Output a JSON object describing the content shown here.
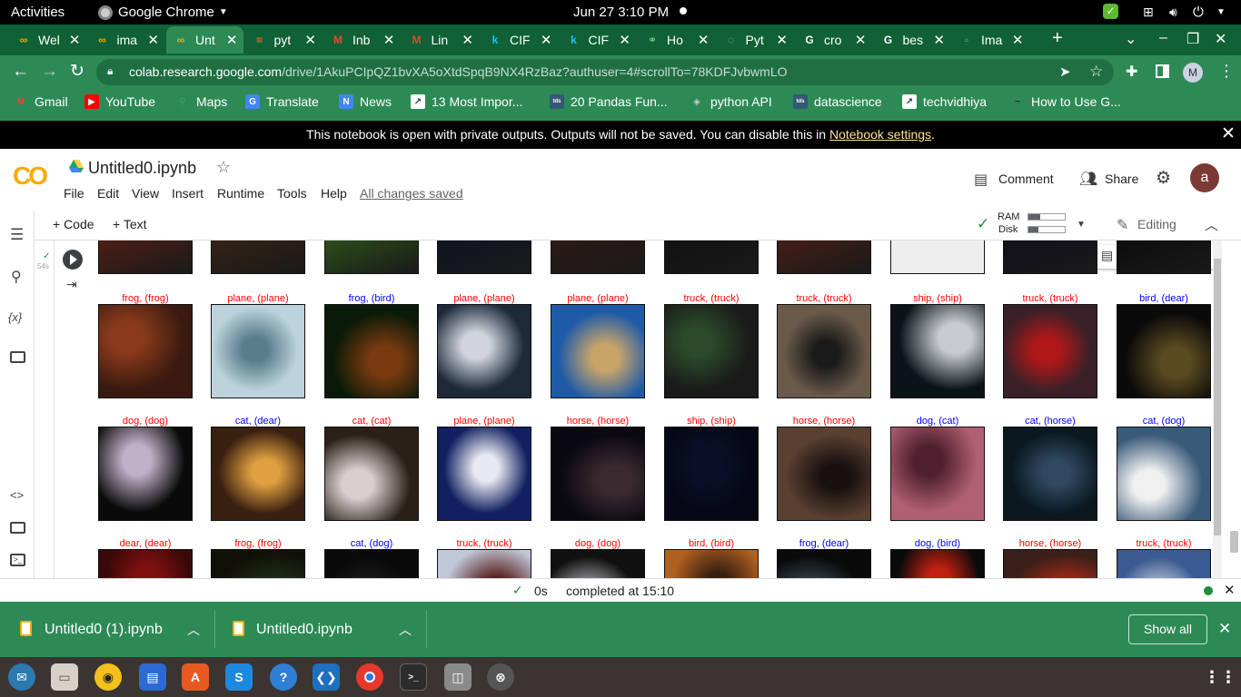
{
  "system": {
    "activities": "Activities",
    "app_name": "Google Chrome",
    "clock": "Jun 27  3:10 PM"
  },
  "tabs": [
    {
      "label": "Wel",
      "icon": "colab-icon"
    },
    {
      "label": "ima",
      "icon": "colab-icon"
    },
    {
      "label": "Unt",
      "icon": "colab-icon",
      "active": true
    },
    {
      "label": "pyt",
      "icon": "stackoverflow-icon"
    },
    {
      "label": "Inb",
      "icon": "gmail-icon"
    },
    {
      "label": "Lin",
      "icon": "gmail-icon"
    },
    {
      "label": "CIF",
      "icon": "kaggle-icon"
    },
    {
      "label": "CIF",
      "icon": "kaggle-icon"
    },
    {
      "label": "Ho",
      "icon": "link-icon"
    },
    {
      "label": "Pyt",
      "icon": "loading-icon"
    },
    {
      "label": "cro",
      "icon": "google-icon"
    },
    {
      "label": "bes",
      "icon": "google-icon"
    },
    {
      "label": "Ima",
      "icon": "page-icon"
    }
  ],
  "address": {
    "host": "colab.research.google.com",
    "path": "/drive/1AkuPCIpQZ1bvXA5oXtdSpqB9NX4RzBaz?authuser=4#scrollTo=78KDFJvbwmLO"
  },
  "profile_initial": "M",
  "bookmarks": [
    {
      "label": "Gmail",
      "icon": "gmail-icon"
    },
    {
      "label": "YouTube",
      "icon": "youtube-icon"
    },
    {
      "label": "Maps",
      "icon": "maps-icon"
    },
    {
      "label": "Translate",
      "icon": "translate-icon"
    },
    {
      "label": "News",
      "icon": "news-icon"
    },
    {
      "label": "13 Most Impor...",
      "icon": "chart-icon"
    },
    {
      "label": "20 Pandas Fun...",
      "icon": "tds-icon"
    },
    {
      "label": "python API",
      "icon": "python-icon"
    },
    {
      "label": "datascience",
      "icon": "tds-icon"
    },
    {
      "label": "techvidhiya",
      "icon": "chart-icon"
    },
    {
      "label": "How to Use G...",
      "icon": "medium-icon"
    }
  ],
  "notice": {
    "text": "This notebook is open with private outputs. Outputs will not be saved. You can disable this in ",
    "link": "Notebook settings",
    "end": "."
  },
  "notebook": {
    "logo": "CO",
    "title": "Untitled0.ipynb",
    "menu": [
      "File",
      "Edit",
      "View",
      "Insert",
      "Runtime",
      "Tools",
      "Help"
    ],
    "saved": "All changes saved",
    "comment": "Comment",
    "share": "Share",
    "avatar": "a",
    "add_code": "+ Code",
    "add_text": "+ Text",
    "ram": "RAM",
    "disk": "Disk",
    "editing": "Editing",
    "exec_time": "54s"
  },
  "output": {
    "row1": [
      {
        "t": "frog, (frog)",
        "c": "#ff0000"
      },
      {
        "t": "plane, (plane)",
        "c": "#ff0000"
      },
      {
        "t": "frog, (bird)",
        "c": "#0000ff"
      },
      {
        "t": "plane, (plane)",
        "c": "#ff0000"
      },
      {
        "t": "plane, (plane)",
        "c": "#ff0000"
      },
      {
        "t": "truck, (truck)",
        "c": "#ff0000"
      },
      {
        "t": "truck, (truck)",
        "c": "#ff0000"
      },
      {
        "t": "ship, (ship)",
        "c": "#ff0000"
      },
      {
        "t": "truck, (truck)",
        "c": "#ff0000"
      },
      {
        "t": "bird, (dear)",
        "c": "#0000ff"
      }
    ],
    "row2": [
      {
        "t": "dog, (dog)",
        "c": "#ff0000"
      },
      {
        "t": "cat, (dear)",
        "c": "#0000ff"
      },
      {
        "t": "cat, (cat)",
        "c": "#ff0000"
      },
      {
        "t": "plane, (plane)",
        "c": "#ff0000"
      },
      {
        "t": "horse, (horse)",
        "c": "#ff0000"
      },
      {
        "t": "ship, (ship)",
        "c": "#ff0000"
      },
      {
        "t": "horse, (horse)",
        "c": "#ff0000"
      },
      {
        "t": "dog, (cat)",
        "c": "#0000ff"
      },
      {
        "t": "cat, (horse)",
        "c": "#0000ff"
      },
      {
        "t": "cat, (dog)",
        "c": "#0000ff"
      }
    ],
    "row3": [
      {
        "t": "dear, (dear)",
        "c": "#ff0000"
      },
      {
        "t": "frog, (frog)",
        "c": "#ff0000"
      },
      {
        "t": "cat, (dog)",
        "c": "#0000ff"
      },
      {
        "t": "truck, (truck)",
        "c": "#ff0000"
      },
      {
        "t": "dog, (dog)",
        "c": "#ff0000"
      },
      {
        "t": "bird, (bird)",
        "c": "#ff0000"
      },
      {
        "t": "frog, (dear)",
        "c": "#0000ff"
      },
      {
        "t": "dog, (bird)",
        "c": "#0000ff"
      },
      {
        "t": "horse, (horse)",
        "c": "#ff0000"
      },
      {
        "t": "truck, (truck)",
        "c": "#ff0000"
      }
    ]
  },
  "status": {
    "seconds": "0s",
    "completed": "completed at 15:10"
  },
  "downloads": {
    "items": [
      "Untitled0 (1).ipynb",
      "Untitled0.ipynb"
    ],
    "show_all": "Show all"
  },
  "colors": {
    "chrome_green": "#2d8a55",
    "tabstrip_green": "#106135",
    "colab_orange": "#f9ab00",
    "correct": "#ff0000",
    "wrong": "#0000ff"
  }
}
